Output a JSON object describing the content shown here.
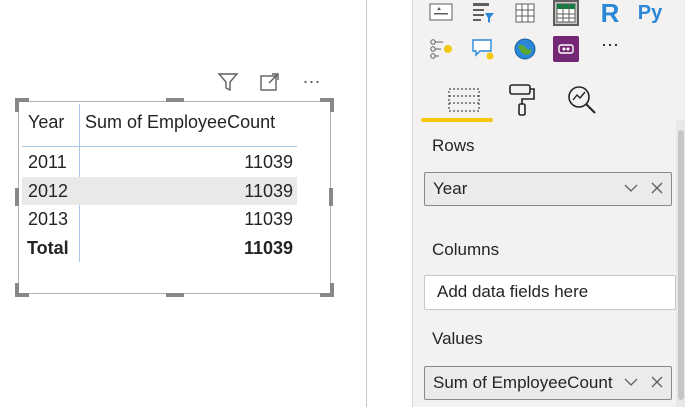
{
  "visual": {
    "table": {
      "headers": [
        "Year",
        "Sum of EmployeeCount"
      ],
      "rows": [
        {
          "year": "2011",
          "value": "11039"
        },
        {
          "year": "2012",
          "value": "11039"
        },
        {
          "year": "2013",
          "value": "11039"
        }
      ],
      "total": {
        "label": "Total",
        "value": "11039"
      }
    },
    "header_icons": [
      "filter-icon",
      "focus-mode-icon",
      "more-options-icon"
    ],
    "more_label": "⋯"
  },
  "visualizations_pane": {
    "icons_row1": [
      "card-icon",
      "slicer-icon",
      "table-icon",
      "matrix-icon",
      "r-visual-icon",
      "python-visual-icon"
    ],
    "icons_row2": [
      "key-influencers-icon",
      "qa-icon",
      "arcgis-map-icon",
      "power-apps-icon",
      "more-visuals-icon"
    ],
    "r_label": "R",
    "py_label": "Py",
    "more_visuals_label": "⋯",
    "tabs": [
      "fields-tab",
      "format-tab",
      "analytics-tab"
    ],
    "wells": {
      "rows": {
        "label": "Rows",
        "field": "Year"
      },
      "columns": {
        "label": "Columns",
        "placeholder": "Add data fields here"
      },
      "values": {
        "label": "Values",
        "field": "Sum of EmployeeCount"
      }
    },
    "chevron": "∨",
    "remove": "×"
  },
  "colors": {
    "accent": "#f2c811",
    "selection": "#a9c7e8",
    "matrix_icon": "#107c41",
    "powerapps": "#742774"
  }
}
